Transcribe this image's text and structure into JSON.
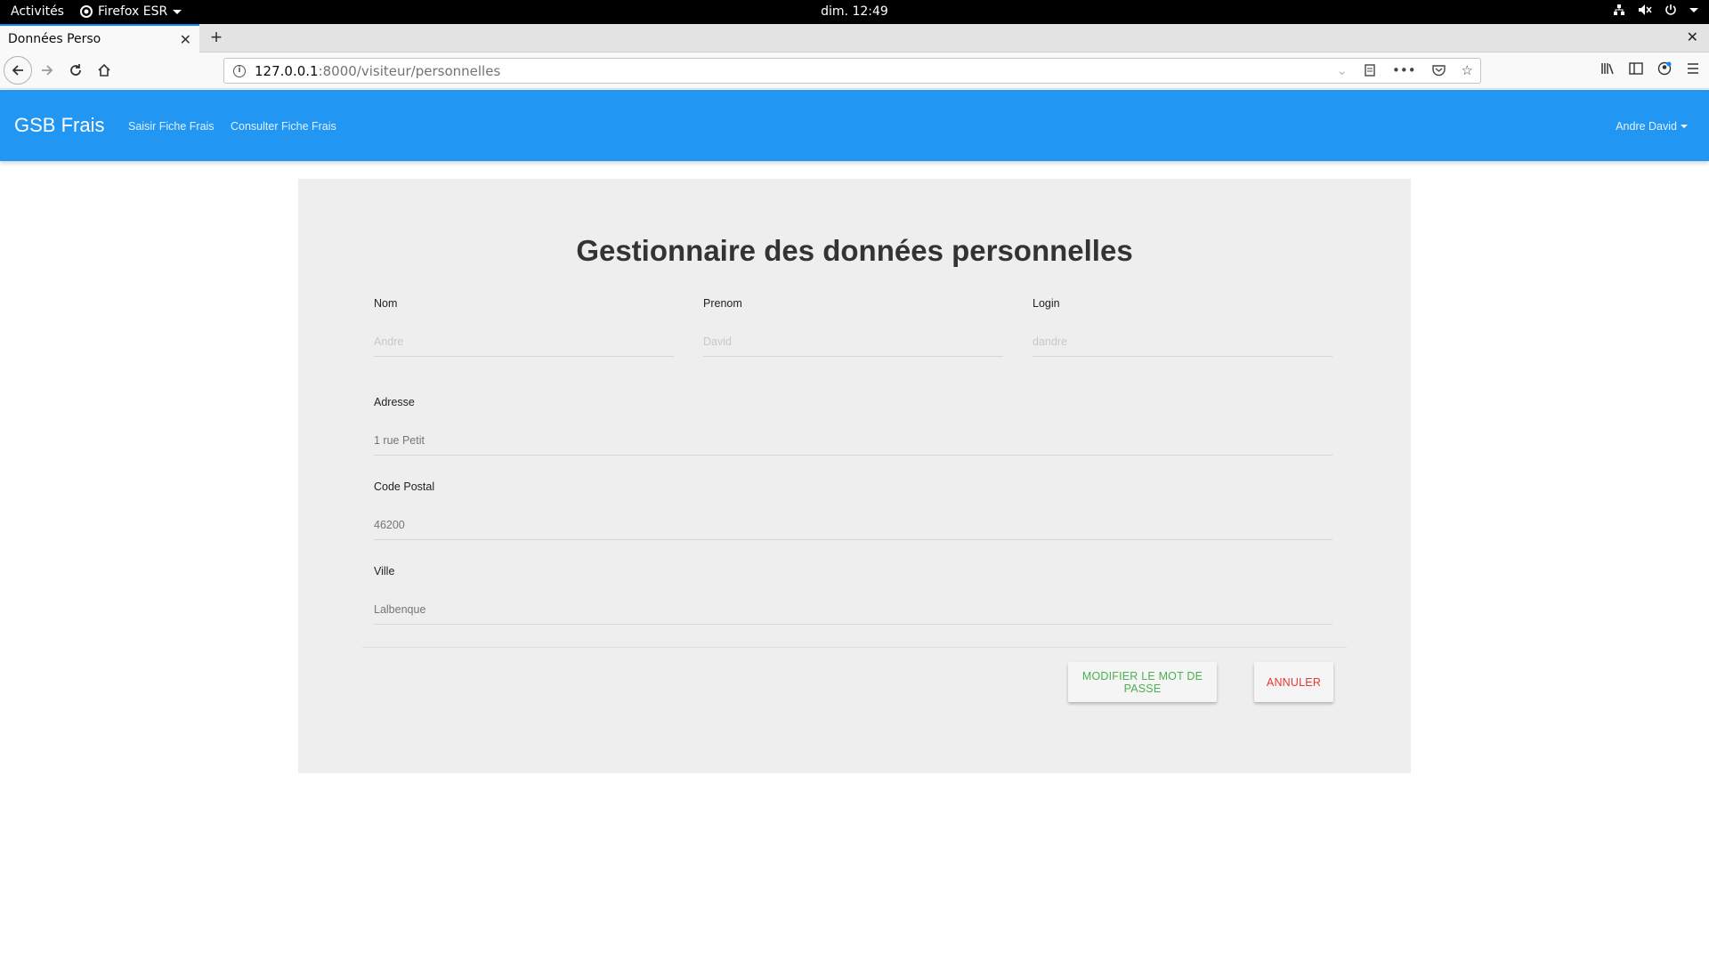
{
  "system": {
    "activities": "Activités",
    "app_menu": "Firefox ESR",
    "clock": "dim. 12:49"
  },
  "browser": {
    "tab_title": "Données Perso",
    "url_host": "127.0.0.1",
    "url_path": ":8000/visiteur/personnelles"
  },
  "app": {
    "brand": "GSB Frais",
    "nav": [
      "Saisir Fiche Frais",
      "Consulter Fiche Frais"
    ],
    "user": "Andre David"
  },
  "form": {
    "title": "Gestionnaire des données personnelles",
    "nom": {
      "label": "Nom",
      "placeholder": "Andre"
    },
    "prenom": {
      "label": "Prenom",
      "placeholder": "David"
    },
    "login": {
      "label": "Login",
      "placeholder": "dandre"
    },
    "adresse": {
      "label": "Adresse",
      "value": "1 rue Petit"
    },
    "code_postal": {
      "label": "Code Postal",
      "value": "46200"
    },
    "ville": {
      "label": "Ville",
      "value": "Lalbenque"
    },
    "btn_password": "MODIFIER LE MOT DE PASSE",
    "btn_cancel": "ANNULER"
  },
  "colors": {
    "navbar": "#2196f3",
    "card": "#eeeeee",
    "password_button_text": "#4caf50",
    "cancel_button_text": "#e53935"
  }
}
